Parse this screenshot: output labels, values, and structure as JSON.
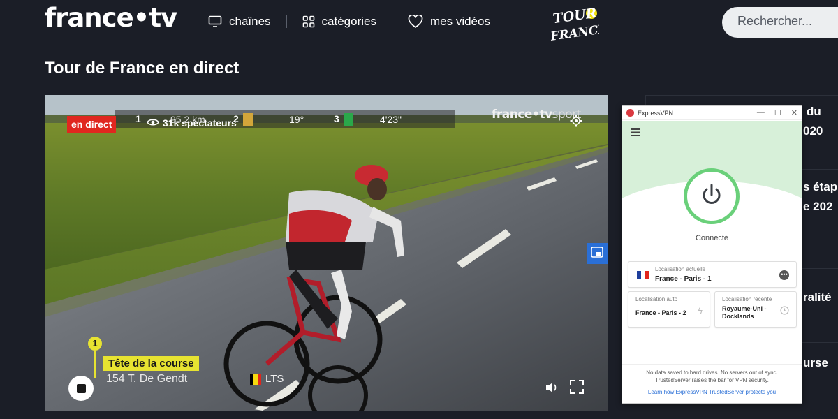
{
  "header": {
    "logo_text": "france•tv",
    "nav": [
      {
        "label": "chaînes",
        "icon": "tv-icon"
      },
      {
        "label": "catégories",
        "icon": "grid-icon"
      },
      {
        "label": "mes vidéos",
        "icon": "heart-icon"
      }
    ],
    "search_placeholder": "Rechercher...",
    "tdf_logo_text": [
      "TOUR",
      "FRANCE"
    ]
  },
  "page": {
    "title": "Tour de France en direct"
  },
  "player": {
    "live_label": "en direct",
    "viewers": "31k spectateurs",
    "brand": "france•tv",
    "brand_suffix": "sport",
    "hud": {
      "jersey1_num": "1",
      "km": "95,2 km",
      "jersey2_num": "2",
      "gradient": "19°",
      "jersey3_num": "3",
      "gap": "4'23\""
    },
    "position_number": "1",
    "lead_label": "Tête de la course",
    "rider": "154 T. De Gendt",
    "team": "LTS",
    "colors": {
      "live": "#e0271f",
      "lead_tag": "#e7e331",
      "pip": "#2a6fd6"
    }
  },
  "sidebar": {
    "card1_lines": [
      "du",
      "020"
    ],
    "card2_lines": [
      "s étap",
      "e 202"
    ],
    "card3_line": "ralité",
    "card4_line": "urse"
  },
  "vpn": {
    "app_title": "ExpressVPN",
    "status": "Connecté",
    "current_location_label": "Localisation actuelle",
    "current_location": "France - Paris - 1",
    "auto_label": "Localisation auto",
    "auto_value": "France - Paris - 2",
    "recent_label": "Localisation récente",
    "recent_value_line1": "Royaume-Uni -",
    "recent_value_line2": "Docklands",
    "footer_line1": "No data saved to hard drives. No servers out of sync.",
    "footer_line2": "TrustedServer raises the bar for VPN security.",
    "link": "Learn how ExpressVPN TrustedServer protects you",
    "colors": {
      "accent_green": "#6ad07a",
      "header_bg": "#d7f0d9",
      "logo_red": "#da3940"
    }
  }
}
